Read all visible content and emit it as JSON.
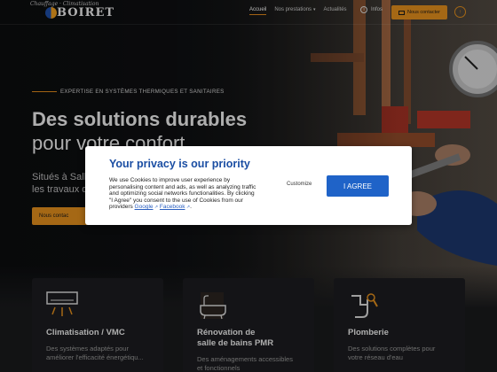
{
  "brand": {
    "tagline": "Chauffage · Climatisation",
    "name": "BOIRET"
  },
  "nav": {
    "items": [
      {
        "label": "Accueil",
        "active": true
      },
      {
        "label": "Nos prestations",
        "has_dropdown": true
      },
      {
        "label": "Actualités"
      }
    ],
    "info_label": "Infos",
    "contact_label": "Nous contacter"
  },
  "hero": {
    "kicker": "EXPERTISE EN SYSTÈMES THERMIQUES ET SANITAIRES",
    "title_bold": "Des solutions durables",
    "title_light": "pour votre confort",
    "lead_line1": "Situés à Salle",
    "lead_line2": "les travaux d",
    "cta_label": "Nous contac"
  },
  "services": [
    {
      "title_lines": [
        "Climatisation / VMC"
      ],
      "desc_lines": [
        "Des systèmes adaptés pour",
        "améliorer l'efficacité énergétiqu..."
      ],
      "icon": "air-conditioner-icon"
    },
    {
      "title_lines": [
        "Rénovation de",
        "salle de bains PMR"
      ],
      "desc_lines": [
        "Des aménagements accessibles",
        "et fonctionnels"
      ],
      "icon": "bathtub-icon"
    },
    {
      "title_lines": [
        "Plomberie"
      ],
      "desc_lines": [
        "Des solutions complètes pour",
        "votre réseau d'eau"
      ],
      "icon": "pipe-wrench-icon"
    }
  ],
  "cookie_modal": {
    "title": "Your privacy is our priority",
    "body_text": "We use Cookies to improve user experience by personalising content and ads, as well as analyzing traffic and optimizing social networks functionalities. By clicking \"I Agree\" you consent to the use of Cookies from our providers",
    "link_google": "Google",
    "link_facebook": "Facebook",
    "link_joiner": " ",
    "period": ".",
    "customize_label": "Customize",
    "agree_label": "I AGREE"
  },
  "colors": {
    "accent_orange": "#e5901e",
    "modal_title_blue": "#1b4ea3",
    "agree_button_blue": "#1f63c8",
    "page_dark": "#1d1e20"
  }
}
